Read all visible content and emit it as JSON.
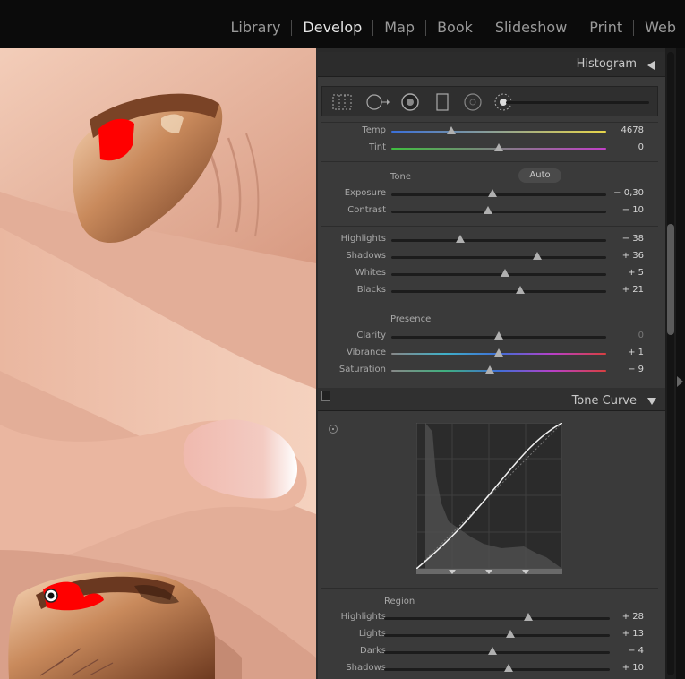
{
  "modules": [
    {
      "label": "Library",
      "active": false
    },
    {
      "label": "Develop",
      "active": true
    },
    {
      "label": "Map",
      "active": false
    },
    {
      "label": "Book",
      "active": false
    },
    {
      "label": "Slideshow",
      "active": false
    },
    {
      "label": "Print",
      "active": false
    },
    {
      "label": "Web",
      "active": false
    }
  ],
  "histogram": {
    "title": "Histogram"
  },
  "tools": [
    "crop-overlay-icon",
    "spot-removal-icon",
    "red-eye-icon",
    "graduated-filter-icon",
    "radial-filter-icon",
    "adjustment-brush-icon"
  ],
  "white_balance": {
    "temp": {
      "label": "Temp",
      "value": "4678",
      "position": 0.28
    },
    "tint": {
      "label": "Tint",
      "value": "0",
      "position": 0.5
    }
  },
  "tone": {
    "title": "Tone",
    "auto_label": "Auto",
    "exposure": {
      "label": "Exposure",
      "value": "− 0,30",
      "position": 0.47
    },
    "contrast": {
      "label": "Contrast",
      "value": "− 10",
      "position": 0.45
    },
    "highlights": {
      "label": "Highlights",
      "value": "− 38",
      "position": 0.32
    },
    "shadows": {
      "label": "Shadows",
      "value": "+ 36",
      "position": 0.68
    },
    "whites": {
      "label": "Whites",
      "value": "+ 5",
      "position": 0.53
    },
    "blacks": {
      "label": "Blacks",
      "value": "+ 21",
      "position": 0.6
    }
  },
  "presence": {
    "title": "Presence",
    "clarity": {
      "label": "Clarity",
      "value": "0",
      "position": 0.5
    },
    "vibrance": {
      "label": "Vibrance",
      "value": "+ 1",
      "position": 0.5
    },
    "saturation": {
      "label": "Saturation",
      "value": "− 9",
      "position": 0.46
    }
  },
  "tone_curve": {
    "title": "Tone Curve",
    "region_title": "Region",
    "highlights": {
      "label": "Highlights",
      "value": "+ 28",
      "position": 0.64
    },
    "lights": {
      "label": "Lights",
      "value": "+ 13",
      "position": 0.56
    },
    "darks": {
      "label": "Darks",
      "value": "− 4",
      "position": 0.48
    },
    "shadows": {
      "label": "Shadows",
      "value": "+ 10",
      "position": 0.55
    }
  },
  "colors": {
    "panel_bg": "#3a3a3a",
    "clipping_red": "#ff0000",
    "temp_gradient": [
      "#3a6fd8",
      "#e8d64a"
    ],
    "tint_gradient": [
      "#3fbf3f",
      "#c23fc8"
    ]
  }
}
